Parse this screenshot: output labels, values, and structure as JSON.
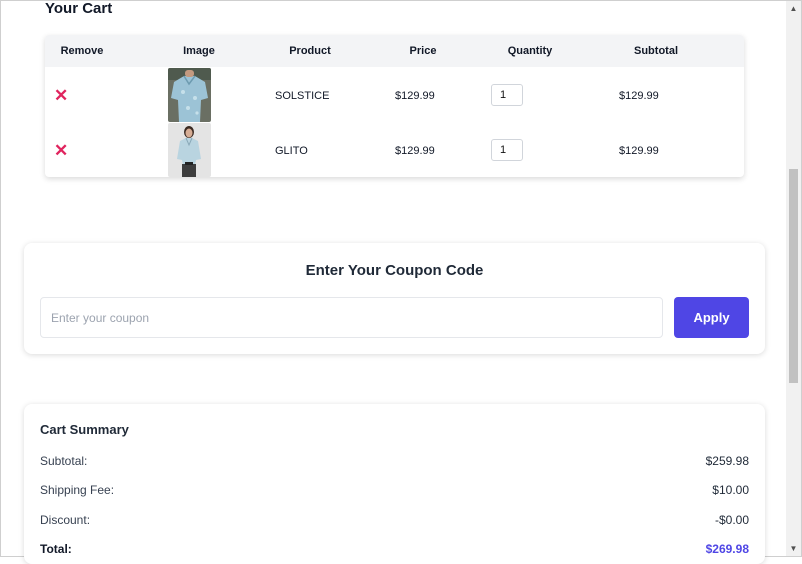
{
  "cart": {
    "title": "Your Cart",
    "headers": [
      "Remove",
      "Image",
      "Product",
      "Price",
      "Quantity",
      "Subtotal"
    ],
    "items": [
      {
        "remove_icon": "close-icon",
        "remove_glyph": "✕",
        "product": "SOLSTICE",
        "price": "$129.99",
        "quantity": "1",
        "subtotal": "$129.99"
      },
      {
        "remove_icon": "close-icon",
        "remove_glyph": "✕",
        "product": "GLITO",
        "price": "$129.99",
        "quantity": "1",
        "subtotal": "$129.99"
      }
    ]
  },
  "coupon": {
    "title": "Enter Your Coupon Code",
    "placeholder": "Enter your coupon",
    "apply_label": "Apply"
  },
  "summary": {
    "title": "Cart Summary",
    "subtotal_label": "Subtotal:",
    "subtotal_value": "$259.98",
    "shipping_label": "Shipping Fee:",
    "shipping_value": "$10.00",
    "discount_label": "Discount:",
    "discount_value": "-$0.00",
    "total_label": "Total:",
    "total_value": "$269.98"
  },
  "colors": {
    "accent": "#4f46e5",
    "remove": "#e0245e"
  }
}
